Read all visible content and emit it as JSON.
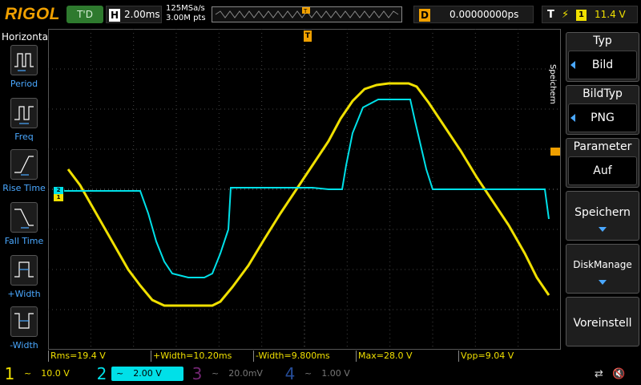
{
  "topbar": {
    "brand": "RIGOL",
    "run_status": "T'D",
    "horizontal_label": "H",
    "timebase": "2.00ms",
    "sample_rate": "125MSa/s",
    "memory_depth": "3.00M pts",
    "trigger_marker": "T",
    "delay_label": "D",
    "delay_value": "0.00000000ps",
    "trigger_label": "T",
    "trigger_edge_icon": "rising-edge-icon",
    "trigger_source": "1",
    "trigger_level": "11.4 V"
  },
  "left_panel": {
    "title": "Horizontal",
    "items": [
      {
        "label": "Period",
        "icon": "period-icon"
      },
      {
        "label": "Freq",
        "icon": "frequency-icon"
      },
      {
        "label": "Rise Time",
        "icon": "rise-time-icon"
      },
      {
        "label": "Fall Time",
        "icon": "fall-time-icon"
      },
      {
        "label": "+Width",
        "icon": "positive-width-icon"
      },
      {
        "label": "-Width",
        "icon": "negative-width-icon"
      }
    ]
  },
  "right_menu": {
    "vertical_label": "Speichern",
    "items": [
      {
        "title": "Typ",
        "value": "Bild"
      },
      {
        "title": "BildTyp",
        "value": "PNG"
      },
      {
        "title": "Parameter",
        "value": "Auf"
      },
      {
        "label": "Speichern"
      },
      {
        "label": "DiskManage"
      },
      {
        "label": "Voreinstell"
      }
    ]
  },
  "measurements": [
    "Rms=19.4 V",
    "+Width=10.20ms",
    "-Width=9.800ms",
    "Max=28.0 V",
    "Vpp=9.04 V"
  ],
  "channels": [
    {
      "num": "1",
      "coupling": "~",
      "scale": "10.0 V",
      "color": "#f0e000",
      "active": true
    },
    {
      "num": "2",
      "coupling": "~",
      "scale": "2.00 V",
      "color": "#00e0e8",
      "active": true
    },
    {
      "num": "3",
      "coupling": "~",
      "scale": "20.0mV",
      "color": "#c040c0",
      "active": false
    },
    {
      "num": "4",
      "coupling": "~",
      "scale": "1.00 V",
      "color": "#4080ff",
      "active": false
    }
  ],
  "markers": {
    "ch1": "1",
    "ch2": "2",
    "trigger_level": "T"
  },
  "colors": {
    "ch1": "#f0e000",
    "ch2": "#00e0e8",
    "accent": "#f0a000",
    "menu_highlight": "#4aa8ff"
  },
  "waveforms": {
    "ch1_shape": "trapezoid-triangle",
    "ch2_shape": "pulse-with-rise-fall"
  },
  "status_icons": [
    "usb-icon",
    "speaker-mute-icon"
  ]
}
